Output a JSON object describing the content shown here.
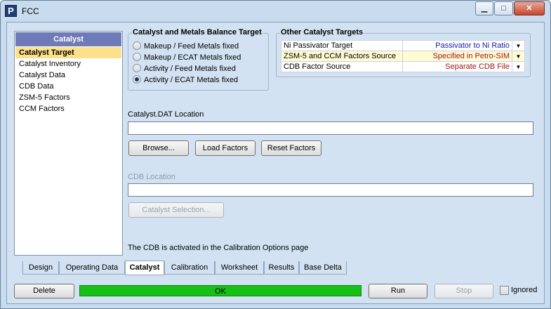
{
  "window": {
    "title": "FCC",
    "app_icon_letter": "P",
    "minimize_glyph": "▁",
    "maximize_glyph": "□",
    "close_glyph": "✕"
  },
  "left_panel": {
    "header": "Catalyst",
    "items": [
      "Catalyst Target",
      "Catalyst Inventory",
      "Catalyst Data",
      "CDB Data",
      "ZSM-5 Factors",
      "CCM Factors"
    ],
    "selected_index": 0
  },
  "balance_group": {
    "legend": "Catalyst and Metals Balance Target",
    "options": [
      "Makeup / Feed Metals fixed",
      "Makeup / ECAT Metals fixed",
      "Activity / Feed Metals fixed",
      "Activity / ECAT Metals fixed"
    ],
    "selected_index": 3
  },
  "other_targets": {
    "legend": "Other Catalyst Targets",
    "dropdown_icon": "chevron-down-icon",
    "rows": [
      {
        "label": "Ni Passivator Target",
        "value": "Passivator to Ni Ratio",
        "value_color": "#1a1aa6",
        "row_bg": "#ffffff"
      },
      {
        "label": "ZSM-5 and CCM Factors Source",
        "value": "Specified in Petro-SIM",
        "value_color": "#a4161a",
        "row_bg": "#fffbd2"
      },
      {
        "label": "CDB Factor Source",
        "value": "Separate CDB File",
        "value_color": "#a4161a",
        "row_bg": "#ffffff"
      }
    ]
  },
  "catalyst_dat": {
    "label": "Catalyst.DAT Location",
    "value": "",
    "browse_label": "Browse...",
    "load_label": "Load Factors",
    "reset_label": "Reset Factors"
  },
  "cdb": {
    "label": "CDB Location",
    "value": "",
    "selection_label": "Catalyst Selection...",
    "note": "The CDB is activated in the Calibration Options page"
  },
  "tabs": [
    "Design",
    "Operating Data",
    "Catalyst",
    "Calibration",
    "Worksheet",
    "Results",
    "Base Delta"
  ],
  "active_tab_index": 2,
  "footer": {
    "delete_label": "Delete",
    "status_text": "OK",
    "status_color": "#16c016",
    "run_label": "Run",
    "stop_label": "Stop",
    "ignored_label": "Ignored",
    "ignored_checked": false
  }
}
